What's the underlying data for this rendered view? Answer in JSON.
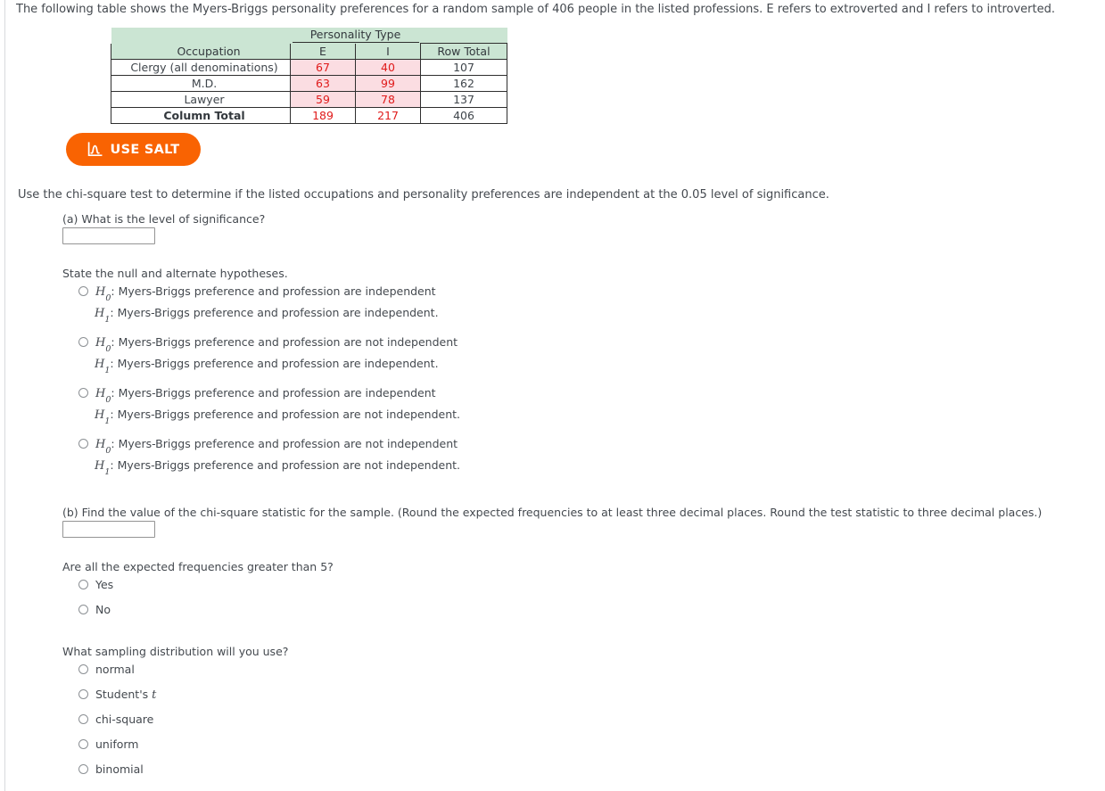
{
  "intro": "The following table shows the Myers-Briggs personality preferences for a random sample of 406 people in the listed professions. E refers to extroverted and I refers to introverted.",
  "table": {
    "group_header": "Personality Type",
    "occupation_header": "Occupation",
    "col_e": "E",
    "col_i": "I",
    "row_total_header": "Row Total",
    "rows": [
      {
        "occupation": "Clergy (all denominations)",
        "e": "67",
        "i": "40",
        "total": "107"
      },
      {
        "occupation": "M.D.",
        "e": "63",
        "i": "99",
        "total": "162"
      },
      {
        "occupation": "Lawyer",
        "e": "59",
        "i": "78",
        "total": "137"
      }
    ],
    "column_total_label": "Column Total",
    "column_total": {
      "e": "189",
      "i": "217",
      "total": "406"
    },
    "colors": {
      "header_bg": "#cbe5d3",
      "observed_bg": "#fbdde2",
      "observed_text": "#e01b1b",
      "border": "#2f2f2f"
    }
  },
  "salt_button": {
    "label": "USE SALT",
    "icon": "distribution-curve-icon",
    "color": "#f96302"
  },
  "instruction": "Use the chi-square test to determine if the listed occupations and personality preferences are independent at the 0.05 level of significance.",
  "part_a": {
    "prompt": "(a) What is the level of significance?",
    "input_value": "",
    "placeholder": ""
  },
  "hypotheses": {
    "prompt": "State the null and alternate hypotheses.",
    "options": [
      {
        "h0": ": Myers-Briggs preference and profession are independent",
        "h1": ": Myers-Briggs preference and profession are independent."
      },
      {
        "h0": ": Myers-Briggs preference and profession are not independent",
        "h1": ": Myers-Briggs preference and profession are independent."
      },
      {
        "h0": ": Myers-Briggs preference and profession are independent",
        "h1": ": Myers-Briggs preference and profession are not independent."
      },
      {
        "h0": ": Myers-Briggs preference and profession are not independent",
        "h1": ": Myers-Briggs preference and profession are not independent."
      }
    ],
    "h0_symbol": "H",
    "h0_sub": "0",
    "h1_symbol": "H",
    "h1_sub": "1"
  },
  "part_b": {
    "prompt": "(b) Find the value of the chi-square statistic for the sample. (Round the expected frequencies to at least three decimal places. Round the test statistic to three decimal places.)",
    "input_value": "",
    "placeholder": ""
  },
  "expected_frequencies": {
    "prompt": "Are all the expected frequencies greater than 5?",
    "options": [
      "Yes",
      "No"
    ]
  },
  "sampling_distribution": {
    "prompt": "What sampling distribution will you use?",
    "options": [
      "normal",
      "Student's ",
      "chi-square",
      "uniform",
      "binomial"
    ],
    "students_t_italic": "t"
  }
}
